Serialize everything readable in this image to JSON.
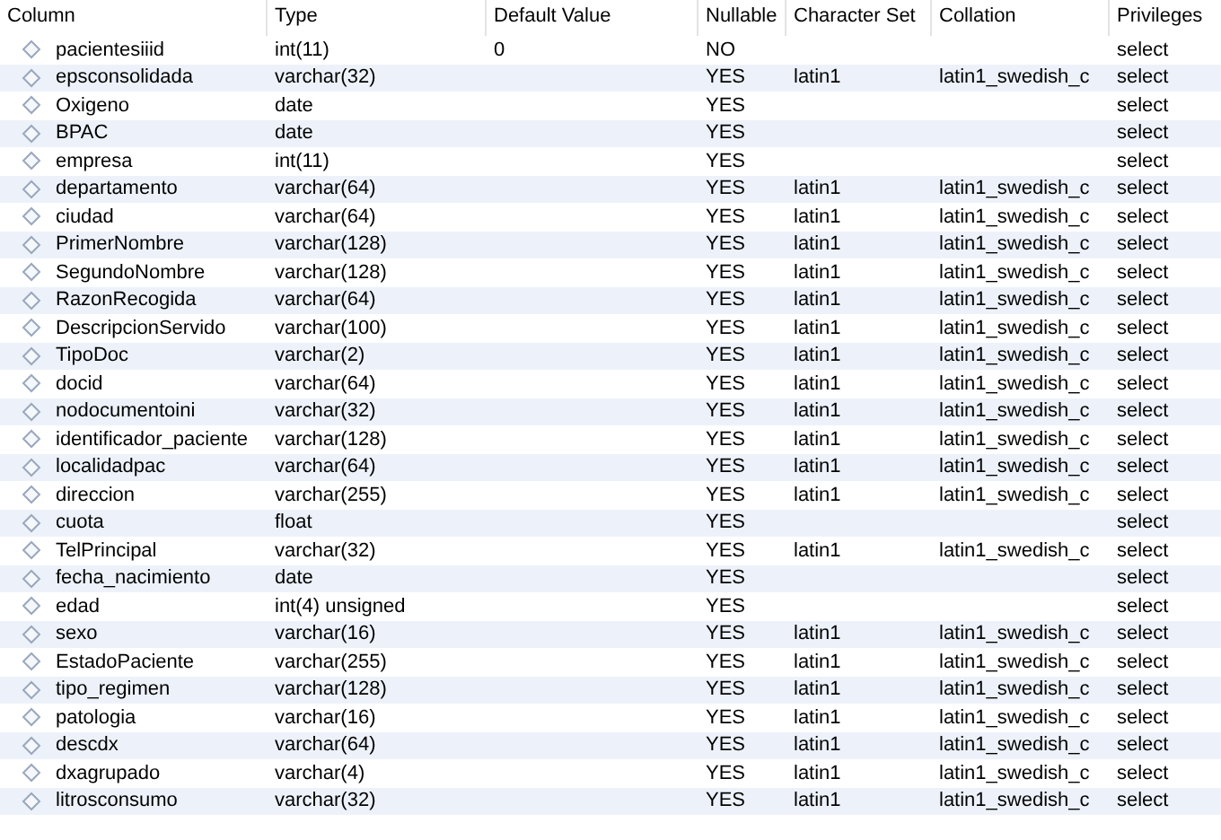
{
  "table": {
    "columns": [
      "Column",
      "Type",
      "Default Value",
      "Nullable",
      "Character Set",
      "Collation",
      "Privileges"
    ],
    "rows": [
      {
        "name": "pacientesiiid",
        "type": "int(11)",
        "default": "0",
        "nullable": "NO",
        "privileges": "select"
      },
      {
        "name": "epsconsolidada",
        "type": "varchar(32)",
        "nullable": "YES",
        "charset": "latin1",
        "collation": "latin1_swedish_c",
        "privileges": "select"
      },
      {
        "name": "Oxigeno",
        "type": "date",
        "nullable": "YES",
        "privileges": "select"
      },
      {
        "name": "BPAC",
        "type": "date",
        "nullable": "YES",
        "privileges": "select"
      },
      {
        "name": "empresa",
        "type": "int(11)",
        "nullable": "YES",
        "privileges": "select"
      },
      {
        "name": "departamento",
        "type": "varchar(64)",
        "nullable": "YES",
        "charset": "latin1",
        "collation": "latin1_swedish_c",
        "privileges": "select"
      },
      {
        "name": "ciudad",
        "type": "varchar(64)",
        "nullable": "YES",
        "charset": "latin1",
        "collation": "latin1_swedish_c",
        "privileges": "select"
      },
      {
        "name": "PrimerNombre",
        "type": "varchar(128)",
        "nullable": "YES",
        "charset": "latin1",
        "collation": "latin1_swedish_c",
        "privileges": "select"
      },
      {
        "name": "SegundoNombre",
        "type": "varchar(128)",
        "nullable": "YES",
        "charset": "latin1",
        "collation": "latin1_swedish_c",
        "privileges": "select"
      },
      {
        "name": "RazonRecogida",
        "type": "varchar(64)",
        "nullable": "YES",
        "charset": "latin1",
        "collation": "latin1_swedish_c",
        "privileges": "select"
      },
      {
        "name": "DescripcionServido",
        "type": "varchar(100)",
        "nullable": "YES",
        "charset": "latin1",
        "collation": "latin1_swedish_c",
        "privileges": "select"
      },
      {
        "name": "TipoDoc",
        "type": "varchar(2)",
        "nullable": "YES",
        "charset": "latin1",
        "collation": "latin1_swedish_c",
        "privileges": "select"
      },
      {
        "name": "docid",
        "type": "varchar(64)",
        "nullable": "YES",
        "charset": "latin1",
        "collation": "latin1_swedish_c",
        "privileges": "select"
      },
      {
        "name": "nodocumentoini",
        "type": "varchar(32)",
        "nullable": "YES",
        "charset": "latin1",
        "collation": "latin1_swedish_c",
        "privileges": "select"
      },
      {
        "name": "identificador_paciente",
        "type": "varchar(128)",
        "nullable": "YES",
        "charset": "latin1",
        "collation": "latin1_swedish_c",
        "privileges": "select"
      },
      {
        "name": "localidadpac",
        "type": "varchar(64)",
        "nullable": "YES",
        "charset": "latin1",
        "collation": "latin1_swedish_c",
        "privileges": "select"
      },
      {
        "name": "direccion",
        "type": "varchar(255)",
        "nullable": "YES",
        "charset": "latin1",
        "collation": "latin1_swedish_c",
        "privileges": "select"
      },
      {
        "name": "cuota",
        "type": "float",
        "nullable": "YES",
        "privileges": "select"
      },
      {
        "name": "TelPrincipal",
        "type": "varchar(32)",
        "nullable": "YES",
        "charset": "latin1",
        "collation": "latin1_swedish_c",
        "privileges": "select"
      },
      {
        "name": "fecha_nacimiento",
        "type": "date",
        "nullable": "YES",
        "privileges": "select"
      },
      {
        "name": "edad",
        "type": "int(4) unsigned",
        "nullable": "YES",
        "privileges": "select"
      },
      {
        "name": "sexo",
        "type": "varchar(16)",
        "nullable": "YES",
        "charset": "latin1",
        "collation": "latin1_swedish_c",
        "privileges": "select"
      },
      {
        "name": "EstadoPaciente",
        "type": "varchar(255)",
        "nullable": "YES",
        "charset": "latin1",
        "collation": "latin1_swedish_c",
        "privileges": "select"
      },
      {
        "name": "tipo_regimen",
        "type": "varchar(128)",
        "nullable": "YES",
        "charset": "latin1",
        "collation": "latin1_swedish_c",
        "privileges": "select"
      },
      {
        "name": "patologia",
        "type": "varchar(16)",
        "nullable": "YES",
        "charset": "latin1",
        "collation": "latin1_swedish_c",
        "privileges": "select"
      },
      {
        "name": "descdx",
        "type": "varchar(64)",
        "nullable": "YES",
        "charset": "latin1",
        "collation": "latin1_swedish_c",
        "privileges": "select"
      },
      {
        "name": "dxagrupado",
        "type": "varchar(4)",
        "nullable": "YES",
        "charset": "latin1",
        "collation": "latin1_swedish_c",
        "privileges": "select"
      },
      {
        "name": "litrosconsumo",
        "type": "varchar(32)",
        "nullable": "YES",
        "charset": "latin1",
        "collation": "latin1_swedish_c",
        "privileges": "select"
      }
    ]
  }
}
